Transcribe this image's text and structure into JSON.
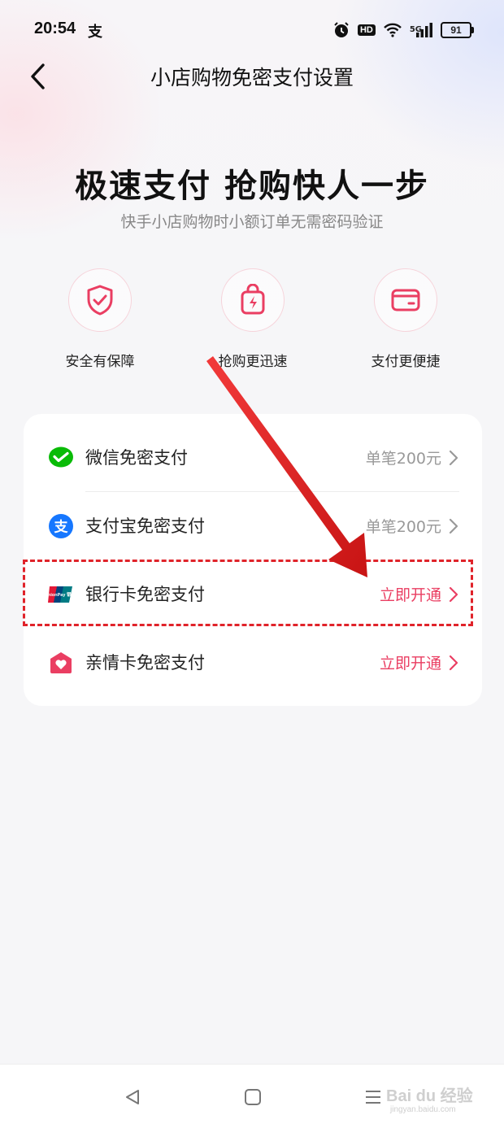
{
  "status_bar": {
    "time": "20:54",
    "alipay_glyph": "支",
    "hd_badge": "HD",
    "network": "5G",
    "battery": "91"
  },
  "nav": {
    "title": "小店购物免密支付设置",
    "back_icon": "chevron-left-icon"
  },
  "hero": {
    "title": "极速支付 抢购快人一步",
    "subtitle": "快手小店购物时小额订单无需密码验证"
  },
  "features": [
    {
      "label": "安全有保障",
      "icon": "shield-check-icon"
    },
    {
      "label": "抢购更迅速",
      "icon": "shopping-bag-bolt-icon"
    },
    {
      "label": "支付更便捷",
      "icon": "wallet-card-icon"
    }
  ],
  "payment_methods": [
    {
      "label": "微信免密支付",
      "value": "单笔200元",
      "icon": "wechat-pay-icon",
      "accent": false
    },
    {
      "label": "支付宝免密支付",
      "value": "单笔200元",
      "icon": "alipay-icon",
      "accent": false
    },
    {
      "label": "银行卡免密支付",
      "value": "立即开通",
      "icon": "unionpay-icon",
      "accent": true
    },
    {
      "label": "亲情卡免密支付",
      "value": "立即开通",
      "icon": "family-card-icon",
      "accent": true
    }
  ],
  "unionpay_logo_text": "UnionPay 银联",
  "colors": {
    "accent": "#ea3e62",
    "annotation_red": "#e0232a",
    "wechat_green": "#09bb07",
    "alipay_blue": "#1677ff"
  },
  "system_nav": {
    "back": "triangle-back-icon",
    "home": "square-home-icon",
    "menu": "menu-lines-icon"
  },
  "watermark": {
    "text": "Bai du 经验",
    "sub": "jingyan.baidu.com"
  }
}
